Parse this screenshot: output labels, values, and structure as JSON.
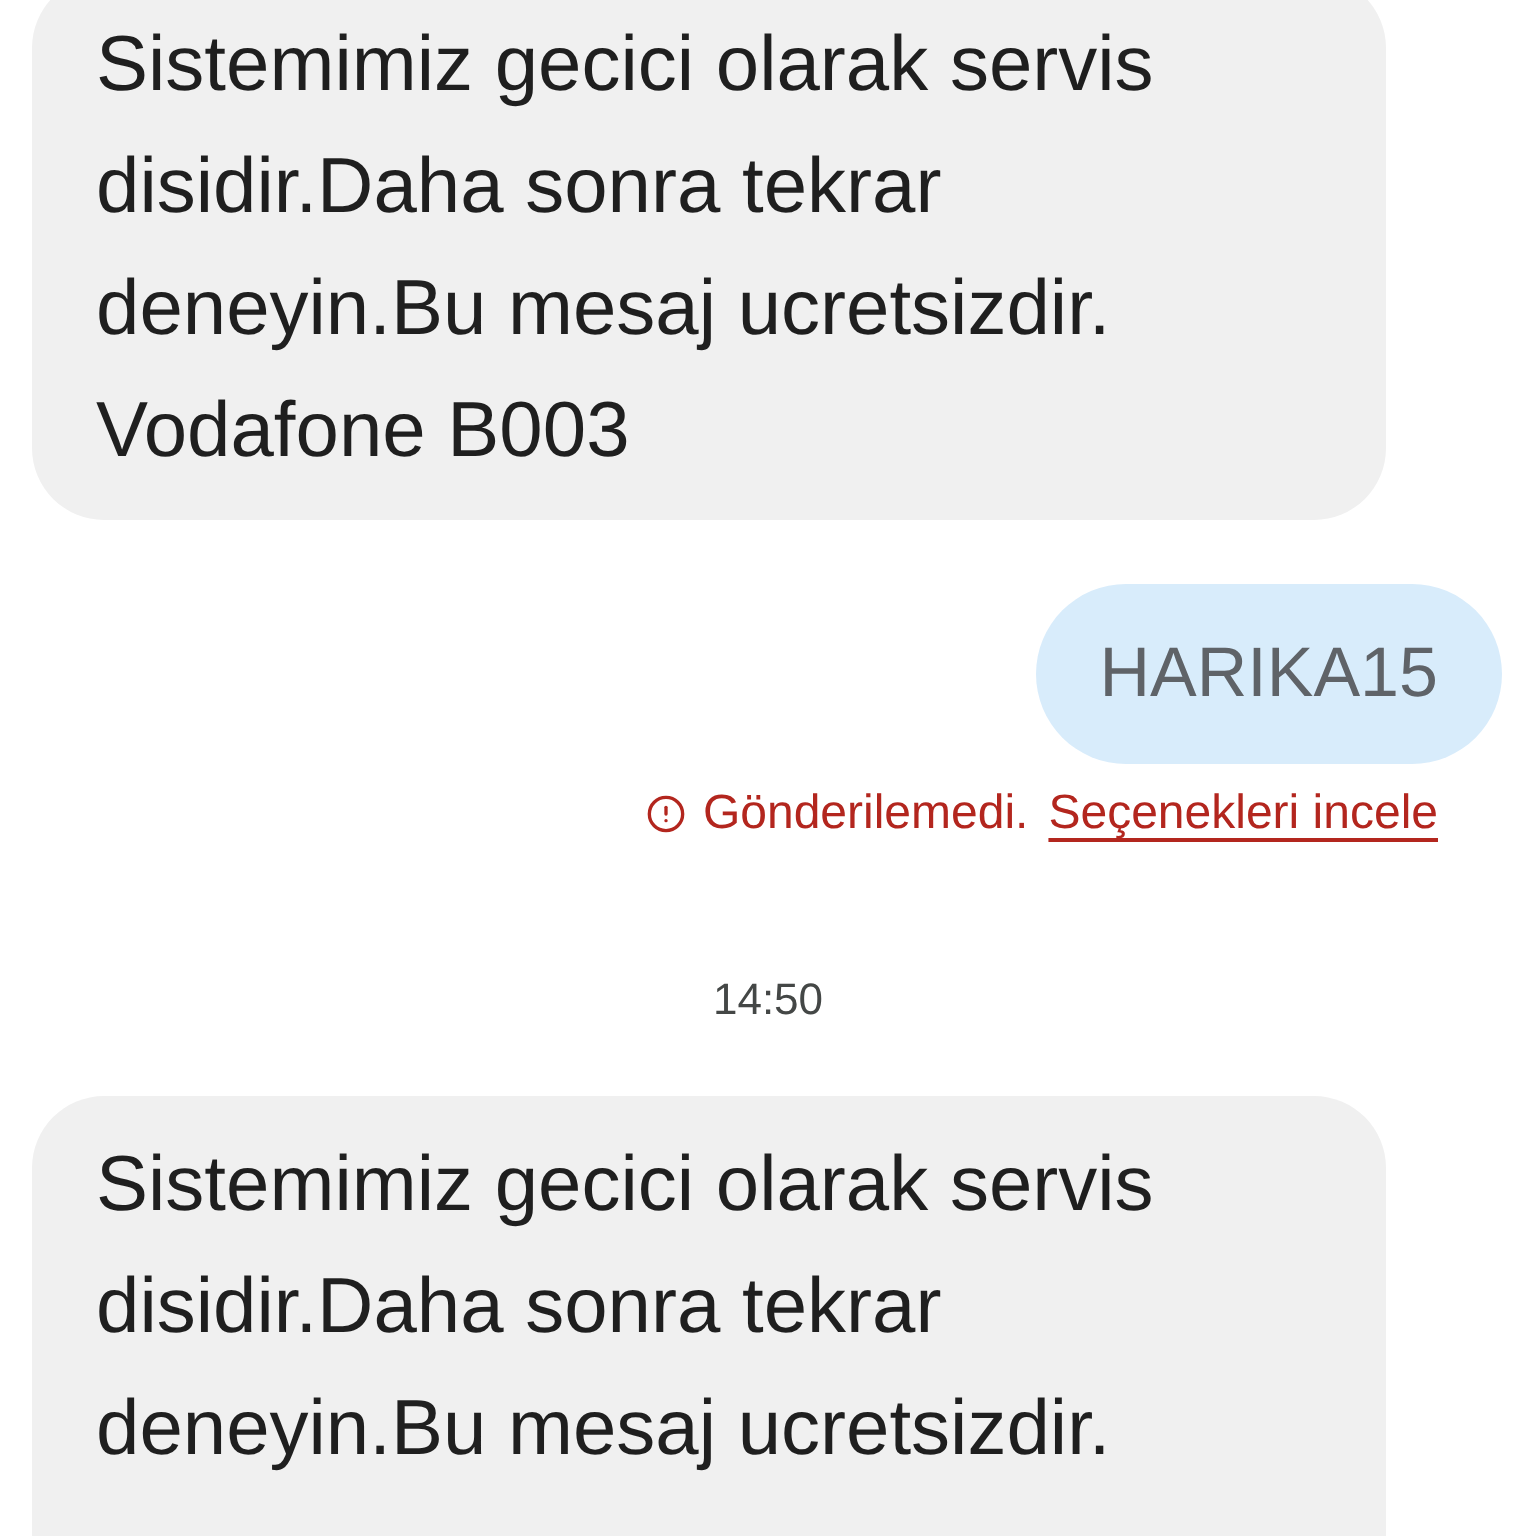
{
  "conversation": [
    {
      "kind": "received",
      "text": "Sistemimiz gecici olarak servis disidir.Daha sonra tekrar deneyin.Bu mesaj ucretsizdir. Vodafone B003"
    },
    {
      "kind": "sent",
      "text": "HARIKA15",
      "failed": true,
      "error": "Gönderilemedi.",
      "action": "Seçenekleri incele"
    },
    {
      "kind": "timestamp",
      "text": "14:50"
    },
    {
      "kind": "received",
      "text": "Sistemimiz gecici olarak servis disidir.Daha sonra tekrar deneyin.Bu mesaj ucretsizdir."
    }
  ]
}
